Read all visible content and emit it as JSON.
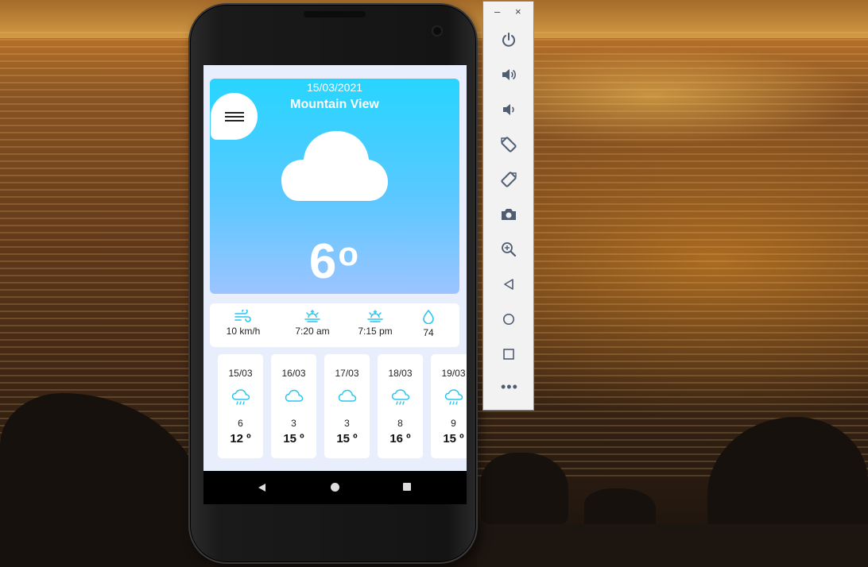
{
  "app": {
    "date": "15/03/2021",
    "city": "Mountain View",
    "current_temp": "6",
    "degree_symbol": "o",
    "weather_icon": "cloud-icon"
  },
  "stats": [
    {
      "icon": "wind-icon",
      "value": "10 km/h"
    },
    {
      "icon": "sunrise-icon",
      "value": "7:20 am"
    },
    {
      "icon": "sunset-icon",
      "value": "7:15 pm"
    },
    {
      "icon": "humidity-drop-icon",
      "value": "74"
    }
  ],
  "forecast": [
    {
      "date": "15/03",
      "icon": "rain-cloud-icon",
      "num": "6",
      "temp": "12 º"
    },
    {
      "date": "16/03",
      "icon": "cloud-icon",
      "num": "3",
      "temp": "15 º"
    },
    {
      "date": "17/03",
      "icon": "cloud-icon",
      "num": "3",
      "temp": "15 º"
    },
    {
      "date": "18/03",
      "icon": "rain-cloud-icon",
      "num": "8",
      "temp": "16 º"
    },
    {
      "date": "19/03",
      "icon": "rain-cloud-icon",
      "num": "9",
      "temp": "15 º"
    }
  ],
  "colors": {
    "hero_top": "#27d5ff",
    "hero_bottom": "#9cc4ff",
    "icon_accent": "#29c6f0",
    "toolbar_icon": "#4f5d73"
  },
  "emulator_toolbar": {
    "minimize": "–",
    "close": "×",
    "buttons": [
      "power-icon",
      "volume-up-icon",
      "volume-down-icon",
      "rotate-left-icon",
      "rotate-right-icon",
      "camera-icon",
      "zoom-icon",
      "back-icon",
      "home-icon",
      "overview-icon"
    ],
    "more": "•••"
  }
}
